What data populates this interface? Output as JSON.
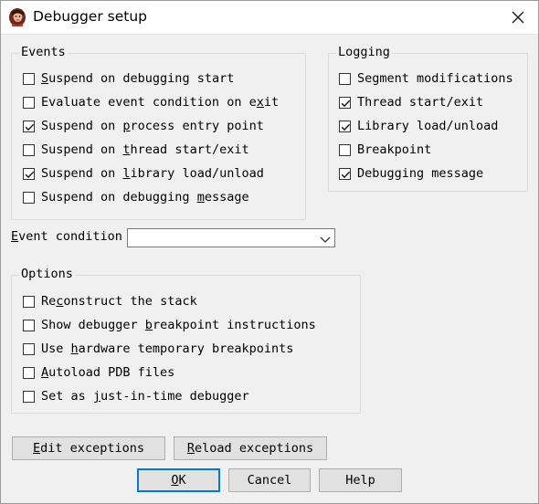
{
  "window": {
    "title": "Debugger setup"
  },
  "events": {
    "title": "Events",
    "items": [
      {
        "pre": "",
        "key": "S",
        "post": "uspend on debugging start",
        "checked": false
      },
      {
        "pre": "Evaluate event condition on e",
        "key": "x",
        "post": "it",
        "checked": false
      },
      {
        "pre": "Suspend on ",
        "key": "p",
        "post": "rocess entry point",
        "checked": true
      },
      {
        "pre": "Suspend on ",
        "key": "t",
        "post": "hread start/exit",
        "checked": false
      },
      {
        "pre": "Suspend on ",
        "key": "l",
        "post": "ibrary load/unload",
        "checked": true
      },
      {
        "pre": "Suspend on debugging ",
        "key": "m",
        "post": "essage",
        "checked": false
      }
    ]
  },
  "logging": {
    "title": "Logging",
    "items": [
      {
        "pre": "Segment modifications",
        "key": "",
        "post": "",
        "checked": false
      },
      {
        "pre": "Thread start/exit",
        "key": "",
        "post": "",
        "checked": true
      },
      {
        "pre": "Library load/unload",
        "key": "",
        "post": "",
        "checked": true
      },
      {
        "pre": "Breakpoint",
        "key": "",
        "post": "",
        "checked": false
      },
      {
        "pre": "Debugging message",
        "key": "",
        "post": "",
        "checked": true
      }
    ]
  },
  "event_condition": {
    "pre": "",
    "key": "E",
    "post": "vent condition",
    "value": ""
  },
  "options": {
    "title": "Options",
    "items": [
      {
        "pre": "Re",
        "key": "c",
        "post": "onstruct the stack",
        "checked": false
      },
      {
        "pre": "Show debugger ",
        "key": "b",
        "post": "reakpoint instructions",
        "checked": false
      },
      {
        "pre": "Use ",
        "key": "h",
        "post": "ardware temporary breakpoints",
        "checked": false
      },
      {
        "pre": "",
        "key": "A",
        "post": "utoload PDB files",
        "checked": false
      },
      {
        "pre": "Set as ",
        "key": "j",
        "post": "ust-in-time debugger",
        "checked": false
      }
    ]
  },
  "buttons": {
    "edit_exceptions": {
      "pre": "",
      "key": "E",
      "post": "dit exceptions"
    },
    "reload_exceptions": {
      "pre": "",
      "key": "R",
      "post": "eload exceptions"
    },
    "ok": {
      "pre": "",
      "key": "O",
      "post": "K"
    },
    "cancel": {
      "pre": "Cancel",
      "key": "",
      "post": ""
    },
    "help": {
      "pre": "Help",
      "key": "",
      "post": ""
    }
  }
}
